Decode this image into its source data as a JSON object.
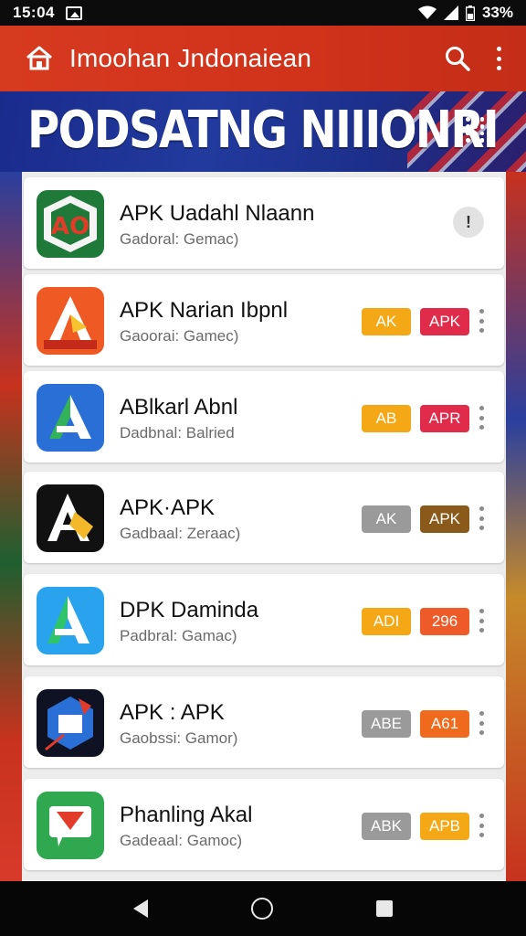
{
  "status_bar": {
    "time": "15:04",
    "battery": "33%"
  },
  "app_bar": {
    "title": "Imoohan Jndonaiean"
  },
  "banner": {
    "title": "PODSATNG NIIIONRI"
  },
  "apps": [
    {
      "name": "APK Uadahl Nlaann",
      "subtitle": "Gadoral: Gemac)",
      "badges": [],
      "action": "info"
    },
    {
      "name": "APK Narian Ibpnl",
      "subtitle": "Gaoorai: Gamec)",
      "badges": [
        {
          "label": "AK",
          "color": "#f5a815"
        },
        {
          "label": "APK",
          "color": "#e02b4b"
        }
      ],
      "action": "menu"
    },
    {
      "name": "ABlkarl Abnl",
      "subtitle": "Dadbnal: Balried",
      "badges": [
        {
          "label": "AB",
          "color": "#f5a815"
        },
        {
          "label": "APR",
          "color": "#e02b4b"
        }
      ],
      "action": "menu"
    },
    {
      "name": "APK·APK",
      "subtitle": "Gadbaal: Zeraac)",
      "badges": [
        {
          "label": "AK",
          "color": "#9a9a9a"
        },
        {
          "label": "APK",
          "color": "#8a5a1a"
        }
      ],
      "action": "menu"
    },
    {
      "name": "DPK Daminda",
      "subtitle": "Padbral: Gamac)",
      "badges": [
        {
          "label": "ADI",
          "color": "#f5a815"
        },
        {
          "label": "296",
          "color": "#ef5b28"
        }
      ],
      "action": "menu"
    },
    {
      "name": "APK : APK",
      "subtitle": "Gaobssi: Gamor)",
      "badges": [
        {
          "label": "ABE",
          "color": "#9a9a9a"
        },
        {
          "label": "A61",
          "color": "#ef6a1c"
        }
      ],
      "action": "menu"
    },
    {
      "name": "Phanling Akal",
      "subtitle": "Gadeaal: Gamoc)",
      "badges": [
        {
          "label": "ABK",
          "color": "#9a9a9a"
        },
        {
          "label": "APB",
          "color": "#f5a815"
        }
      ],
      "action": "menu"
    }
  ],
  "icons": {
    "app_bar": [
      "home-icon",
      "search-icon",
      "more-vert-icon"
    ],
    "banner": "apps-grid-icon",
    "nav": [
      "back-icon",
      "home-circle-icon",
      "recents-icon"
    ]
  },
  "colors": {
    "app_bar": "#d0321a",
    "banner": "#1f3190",
    "card": "#ffffff"
  }
}
